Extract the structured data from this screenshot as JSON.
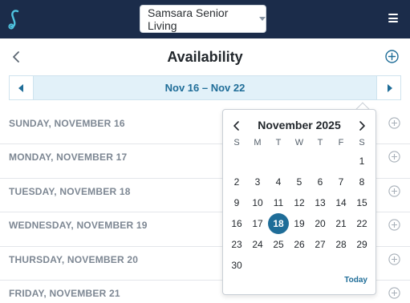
{
  "header": {
    "org_name": "Samsara Senior Living"
  },
  "page": {
    "title": "Availability"
  },
  "week_nav": {
    "range": "Nov 16 – Nov 22"
  },
  "days": [
    {
      "label": "SUNDAY, NOVEMBER 16"
    },
    {
      "label": "MONDAY, NOVEMBER 17"
    },
    {
      "label": "TUESDAY, NOVEMBER 18"
    },
    {
      "label": "WEDNESDAY, NOVEMBER 19"
    },
    {
      "label": "THURSDAY, NOVEMBER 20"
    },
    {
      "label": "FRIDAY, NOVEMBER 21"
    }
  ],
  "calendar": {
    "month_label": "November 2025",
    "weekdays": [
      "S",
      "M",
      "T",
      "W",
      "T",
      "F",
      "S"
    ],
    "weeks": [
      [
        "",
        "",
        "",
        "",
        "",
        "",
        "1"
      ],
      [
        "2",
        "3",
        "4",
        "5",
        "6",
        "7",
        "8"
      ],
      [
        "9",
        "10",
        "11",
        "12",
        "13",
        "14",
        "15"
      ],
      [
        "16",
        "17",
        "18",
        "19",
        "20",
        "21",
        "22"
      ],
      [
        "23",
        "24",
        "25",
        "26",
        "27",
        "28",
        "29"
      ],
      [
        "30",
        "",
        "",
        "",
        "",
        "",
        ""
      ]
    ],
    "selected_day": "18",
    "today_label": "Today"
  },
  "colors": {
    "topbar": "#1b2c4a",
    "accent": "#1f6d98",
    "week_bg": "#e2f1f9",
    "logo": "#4fc3df"
  }
}
